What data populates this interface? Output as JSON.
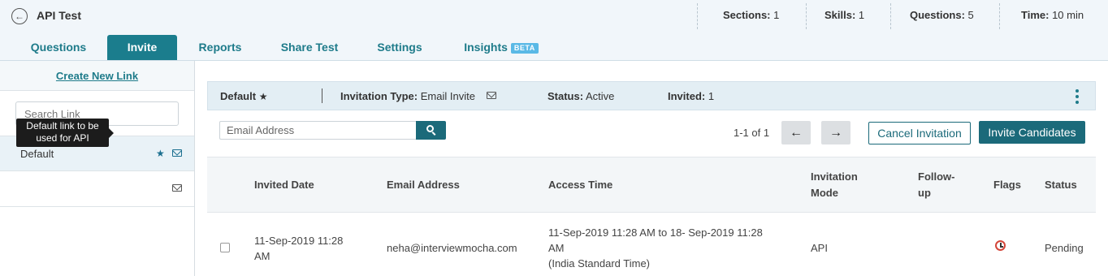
{
  "header": {
    "title": "API Test",
    "stats": [
      {
        "label": "Sections:",
        "value": "1"
      },
      {
        "label": "Skills:",
        "value": "1"
      },
      {
        "label": "Questions:",
        "value": "5"
      },
      {
        "label": "Time:",
        "value": "10 min"
      }
    ]
  },
  "tabs": [
    {
      "label": "Questions",
      "active": false
    },
    {
      "label": "Invite",
      "active": true
    },
    {
      "label": "Reports",
      "active": false
    },
    {
      "label": "Share Test",
      "active": false
    },
    {
      "label": "Settings",
      "active": false
    },
    {
      "label": "Insights",
      "active": false,
      "badge": "BETA"
    }
  ],
  "sidebar": {
    "create_link": "Create New Link",
    "search_placeholder": "Search Link",
    "links": [
      {
        "label": "Default",
        "selected": true
      }
    ],
    "tooltip": "Default link to be used for API"
  },
  "link_info": {
    "name": "Default",
    "invitation_type_label": "Invitation Type:",
    "invitation_type": "Email Invite",
    "status_label": "Status:",
    "status": "Active",
    "invited_label": "Invited:",
    "invited": "1"
  },
  "toolbar": {
    "email_placeholder": "Email Address",
    "pager": "1-1 of 1",
    "prev_icon": "←",
    "next_icon": "→",
    "cancel_label": "Cancel Invitation",
    "invite_label": "Invite Candidates"
  },
  "table": {
    "columns": [
      "Invited Date",
      "Email Address",
      "Access Time",
      "Invitation Mode",
      "Follow-up",
      "Flags",
      "Status"
    ],
    "column_lines": {
      "invitation_mode": [
        "Invitation",
        "Mode"
      ],
      "follow_up": [
        "Follow-",
        "up"
      ]
    },
    "rows": [
      {
        "invited_date_lines": [
          "11-Sep-2019 11:28",
          "AM"
        ],
        "email": "neha@interviewmocha.com",
        "access_time_lines": [
          "11-Sep-2019 11:28 AM to 18- Sep-2019 11:28",
          "AM",
          "(India Standard Time)"
        ],
        "mode": "API",
        "follow_up": "",
        "flag_icon": "alarm-clock-icon",
        "status": "Pending"
      }
    ]
  },
  "colors": {
    "accent": "#1b7d8d",
    "header_bg": "#f1f6fa",
    "info_bar_bg": "#e3eef4",
    "flag_red": "#d4463a"
  }
}
